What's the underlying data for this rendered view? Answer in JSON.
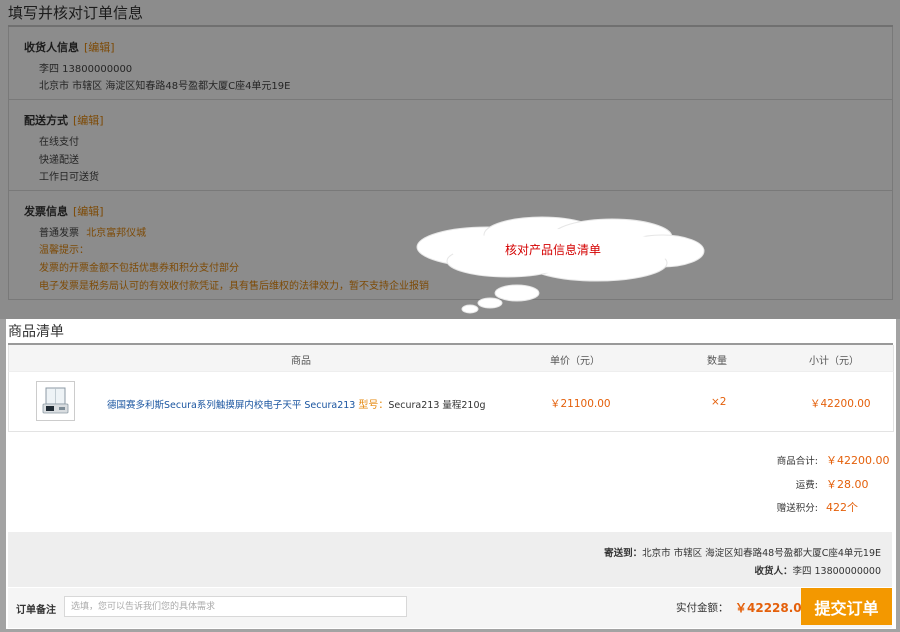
{
  "page_title": "填写并核对订单信息",
  "consignee": {
    "heading": "收货人信息",
    "edit": "[编辑]",
    "name_phone": "李四 13800000000",
    "address": "北京市 市辖区 海淀区知春路48号盈都大厦C座4单元19E"
  },
  "delivery": {
    "heading": "配送方式",
    "edit": "[编辑]",
    "payment": "在线支付",
    "shipping": "快递配送",
    "time": "工作日可送货"
  },
  "invoice": {
    "heading": "发票信息",
    "edit": "[编辑]",
    "type": "普通发票",
    "company": "北京富邦仪城",
    "tip_title": "温馨提示：",
    "tip_1": "发票的开票金额不包括优惠券和积分支付部分",
    "tip_2": "电子发票是税务局认可的有效收付款凭证，具有售后维权的法律效力，暂不支持企业报销"
  },
  "callout": {
    "text": "核对产品信息清单"
  },
  "product_list": {
    "title": "商品清单",
    "columns": {
      "product": "商品",
      "unit_price": "单价（元）",
      "quantity": "数量",
      "subtotal": "小计（元）"
    },
    "item": {
      "name": "德国赛多利斯Secura系列触摸屏内校电子天平 Secura213",
      "model_label": "型号：",
      "model_value": "Secura213 量程210g",
      "unit_price": "￥21100.00",
      "quantity": "×2",
      "subtotal": "￥42200.00"
    }
  },
  "summary": {
    "goods_total_label": "商品合计:",
    "goods_total": "￥42200.00",
    "freight_label": "运费:",
    "freight": "￥28.00",
    "points_label": "赠送积分:",
    "points": "422个"
  },
  "shipping_info": {
    "ship_to_label": "寄送到：",
    "ship_to": "北京市 市辖区 海淀区知春路48号盈都大厦C座4单元19E",
    "consignee_label": "收货人：",
    "consignee": "李四 13800000000"
  },
  "footer": {
    "note_label": "订单备注",
    "note_placeholder": "选填，您可以告诉我们您的具体需求",
    "pay_label": "实付金额：",
    "pay_value": "￥42228.00",
    "submit": "提交订单"
  },
  "colors": {
    "accent": "#f39800",
    "price": "#e4600b",
    "link": "#1a55a0",
    "callout_text": "#d40000"
  }
}
